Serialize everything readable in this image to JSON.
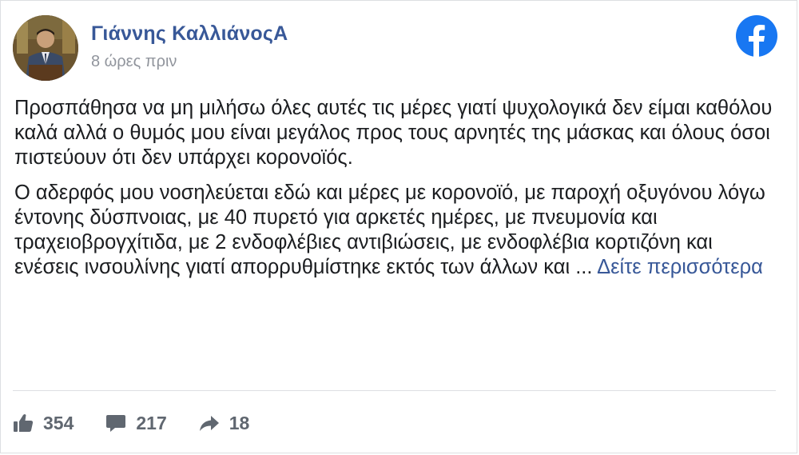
{
  "post": {
    "author": "Γιάννης ΚαλλιάνοςΑ",
    "timestamp": "8 ώρες πριν",
    "paragraph1": "Προσπάθησα να μη μιλήσω όλες αυτές τις μέρες γιατί ψυχολογικά δεν είμαι καθόλου καλά αλλά ο θυμός μου είναι μεγάλος προς τους αρνητές της μάσκας και όλους όσοι πιστεύουν ότι δεν υπάρχει κορονοϊός.",
    "paragraph2": "Ο αδερφός μου νοσηλεύεται εδώ και μέρες με κορονοϊό, με παροχή οξυγόνου λόγω έντονης δύσπνοιας, με 40 πυρετό για αρκετές ημέρες, με πνευμονία και τραχειοβρογχίτιδα, με 2 ενδοφλέβιες αντιβιώσεις, με ενδοφλέβια κορτιζόνη και ενέσεις ινσουλίνης γιατί απορρυθμίστηκε εκτός των άλλων και ...",
    "see_more": "Δείτε περισσότερα"
  },
  "stats": {
    "likes": "354",
    "comments": "217",
    "shares": "18"
  },
  "icons": {
    "brand": "facebook-icon",
    "like": "thumbs-up-icon",
    "comment": "comment-icon",
    "share": "share-arrow-icon"
  },
  "colors": {
    "brand": "#1877f2",
    "link": "#385898",
    "text": "#1c1e21",
    "muted": "#606770"
  }
}
